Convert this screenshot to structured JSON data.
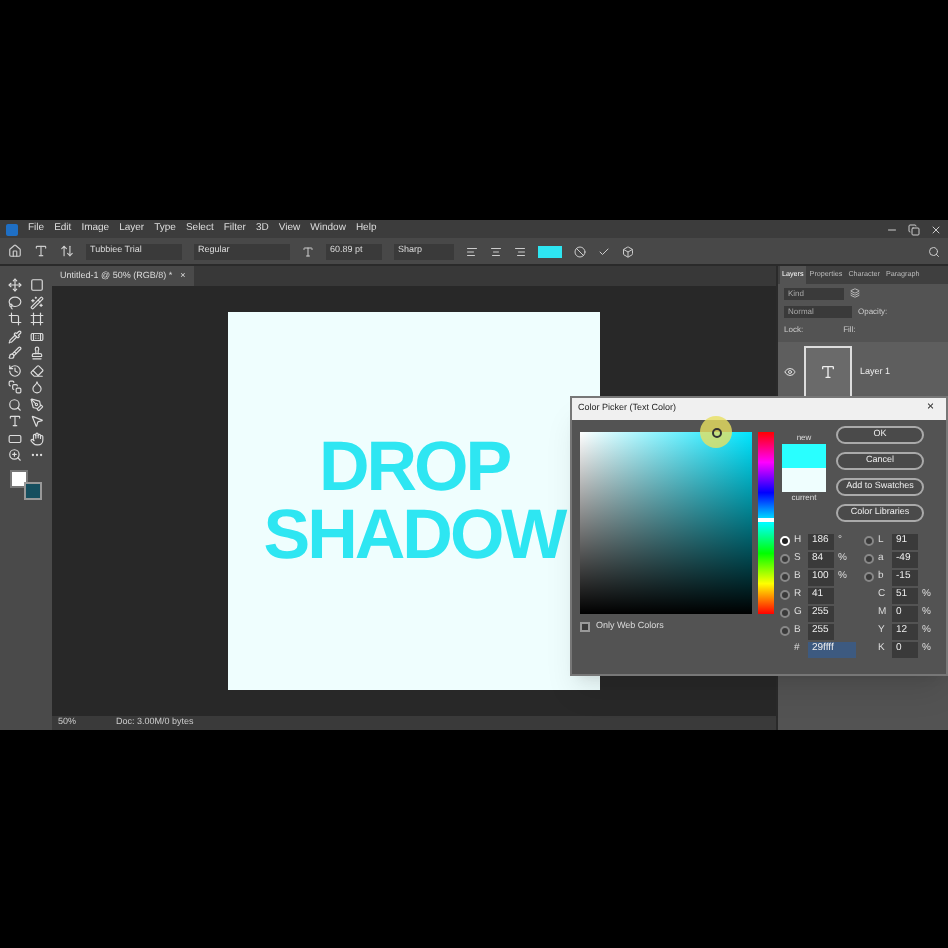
{
  "menu_bar": {
    "items": [
      "File",
      "Edit",
      "Image",
      "Layer",
      "Type",
      "Select",
      "Filter",
      "3D",
      "View",
      "Window",
      "Help"
    ]
  },
  "options_bar": {
    "font_family": "Tubbiee Trial",
    "font_style": "Regular",
    "font_size": "60.89 pt",
    "anti_alias": "Sharp"
  },
  "document_tab": {
    "title": "Untitled-1 @ 50% (RGB/8) *",
    "close": "×"
  },
  "canvas": {
    "lines": [
      "DROP",
      "SHADOW"
    ]
  },
  "layers_panel": {
    "tabs": [
      {
        "label": "Layers",
        "selected": true
      },
      {
        "label": "Properties",
        "selected": false
      },
      {
        "label": "Character",
        "selected": false
      },
      {
        "label": "Paragraph",
        "selected": false
      }
    ],
    "search_placeholder": "Kind",
    "blend_mode": "Normal",
    "opacity_label": "Opacity:",
    "lock_label": "Lock:",
    "fill_label": "Fill:",
    "layer": {
      "name": "Layer 1",
      "visible": true
    }
  },
  "status_bar": {
    "zoom": "50%",
    "doc": "Doc: 3.00M/0 bytes"
  },
  "color_picker": {
    "title": "Color Picker (Text Color)",
    "close": "×",
    "new_label": "new",
    "current_label": "current",
    "swatches": [
      {
        "kind": "new",
        "color": "#29ffff"
      },
      {
        "kind": "current",
        "color": "#effefe"
      }
    ],
    "hue_slider": {
      "level": 0.52
    },
    "buttons": [
      "OK",
      "Cancel",
      "Add to Swatches",
      "Color Libraries"
    ],
    "left_fields": [
      {
        "label": "H",
        "value": "186",
        "unit": "°",
        "kind": "radio",
        "selected": true
      },
      {
        "label": "S",
        "value": "84",
        "unit": "%",
        "kind": "radio",
        "selected": false
      },
      {
        "label": "B",
        "value": "100",
        "unit": "%",
        "kind": "radio",
        "selected": false
      },
      {
        "label": "R",
        "value": "41",
        "kind": "radio",
        "selected": false
      },
      {
        "label": "G",
        "value": "255",
        "kind": "radio",
        "selected": false
      },
      {
        "label": "B",
        "value": "255",
        "kind": "radio",
        "selected": false
      },
      {
        "label": "#",
        "value": "29ffff",
        "kind": "hex"
      }
    ],
    "right_fields": [
      {
        "label": "L",
        "value": "91",
        "kind": "radio",
        "selected": false
      },
      {
        "label": "a",
        "value": "-49",
        "kind": "radio",
        "selected": false
      },
      {
        "label": "b",
        "value": "-15",
        "kind": "radio",
        "selected": false
      },
      {
        "label": "C",
        "value": "51",
        "unit": "%",
        "kind": "plain"
      },
      {
        "label": "M",
        "value": "0",
        "unit": "%",
        "kind": "plain"
      },
      {
        "label": "Y",
        "value": "12",
        "unit": "%",
        "kind": "plain"
      },
      {
        "label": "K",
        "value": "0",
        "unit": "%",
        "kind": "plain"
      }
    ],
    "only_web_colors": {
      "label": "Only Web Colors",
      "checked": false
    }
  }
}
